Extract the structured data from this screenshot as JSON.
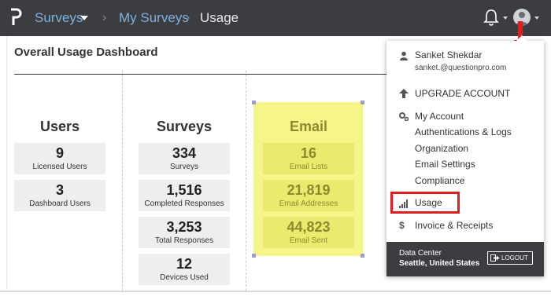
{
  "header": {
    "menu_label": "Surveys",
    "breadcrumb_link": "My Surveys",
    "breadcrumb_current": "Usage",
    "separator": "›"
  },
  "dashboard": {
    "title": "Overall Usage Dashboard",
    "users": {
      "title": "Users",
      "stats": [
        {
          "value": "9",
          "label": "Licensed Users"
        },
        {
          "value": "3",
          "label": "Dashboard Users"
        }
      ]
    },
    "surveys": {
      "title": "Surveys",
      "stats": [
        {
          "value": "334",
          "label": "Surveys"
        },
        {
          "value": "1,516",
          "label": "Completed Responses"
        },
        {
          "value": "3,253",
          "label": "Total Responses"
        },
        {
          "value": "12",
          "label": "Devices Used"
        }
      ]
    },
    "email": {
      "title": "Email",
      "stats": [
        {
          "value": "16",
          "label": "Email Lists"
        },
        {
          "value": "21,819",
          "label": "Email Addresses"
        },
        {
          "value": "44,823",
          "label": "Email Sent"
        }
      ]
    }
  },
  "dropdown": {
    "user_name": "Sanket Shekdar",
    "user_email": "sanket.@questionpro.com",
    "upgrade": "UPGRADE ACCOUNT",
    "my_account": "My Account",
    "account_items": [
      "Authentications & Logs",
      "Organization",
      "Email Settings",
      "Compliance"
    ],
    "usage": "Usage",
    "invoice": "Invoice & Receipts",
    "data_center_label": "Data Center",
    "data_center_value": "Seattle, United States",
    "logout": "LOGOUT"
  },
  "colors": {
    "topbar": "#3b3d40",
    "link": "#7fb1e0",
    "highlight": "#f6f58a",
    "annotation_red": "#e01e1e"
  },
  "icons": [
    "p-logo-icon",
    "bell-icon",
    "avatar-icon",
    "user-icon",
    "arrow-up-icon",
    "gears-icon",
    "bar-chart-icon",
    "dollar-icon",
    "logout-icon"
  ]
}
